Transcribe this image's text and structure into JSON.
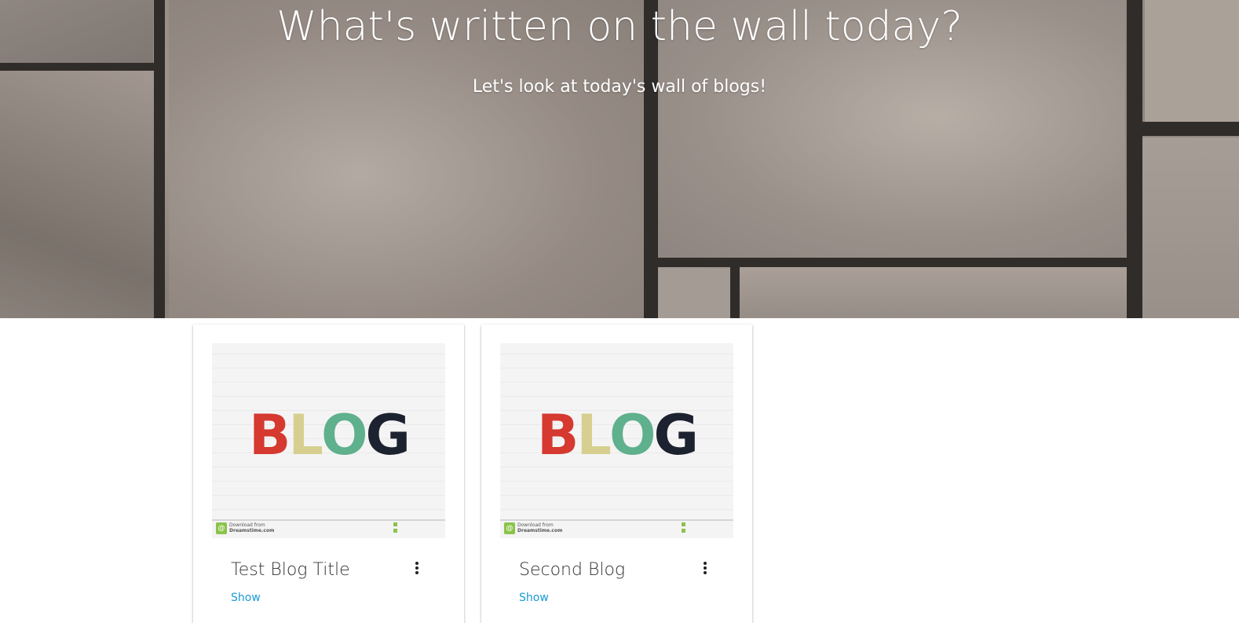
{
  "hero": {
    "title": "What's written on the wall today?",
    "subtitle": "Let's look at today's wall of blogs!"
  },
  "colors": {
    "link": "#1a9bd7",
    "blog_b": "#d5392f",
    "blog_l": "#d6cf8f",
    "blog_o": "#5fb08d",
    "blog_g": "#1d2230"
  },
  "blog_image": {
    "letters": [
      "B",
      "L",
      "O",
      "G"
    ],
    "watermark_line1": "Download from",
    "watermark_line2": "Dreamstime.com"
  },
  "cards": [
    {
      "title": "Test Blog Title",
      "link_label": "Show",
      "menu_icon": "more-vertical-icon"
    },
    {
      "title": "Second Blog",
      "link_label": "Show",
      "menu_icon": "more-vertical-icon"
    }
  ]
}
